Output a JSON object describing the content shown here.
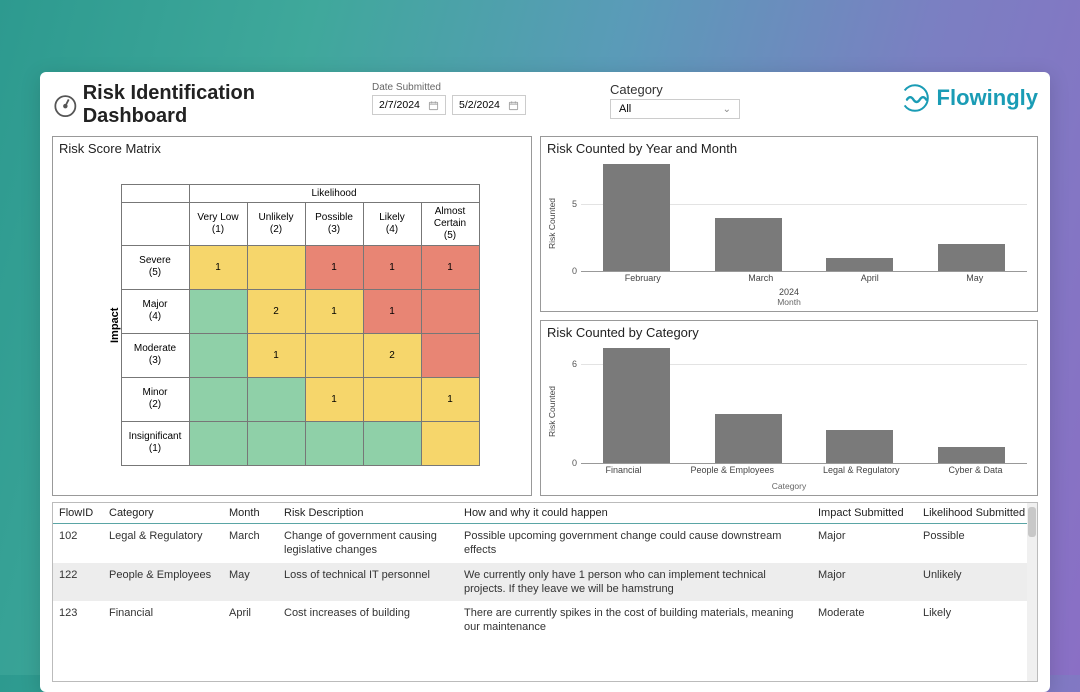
{
  "header": {
    "title": "Risk Identification Dashboard",
    "date_label": "Date Submitted",
    "date_from": "2/7/2024",
    "date_to": "5/2/2024",
    "category_label": "Category",
    "category_value": "All",
    "brand": "Flowingly"
  },
  "matrix": {
    "panel_title": "Risk Score Matrix",
    "likelihood_label": "Likelihood",
    "impact_label": "Impact",
    "col_headers": [
      {
        "name": "Very Low",
        "n": "(1)"
      },
      {
        "name": "Unlikely",
        "n": "(2)"
      },
      {
        "name": "Possible",
        "n": "(3)"
      },
      {
        "name": "Likely",
        "n": "(4)"
      },
      {
        "name": "Almost Certain",
        "n": "(5)"
      }
    ],
    "row_headers": [
      {
        "name": "Severe",
        "n": "(5)"
      },
      {
        "name": "Major",
        "n": "(4)"
      },
      {
        "name": "Moderate",
        "n": "(3)"
      },
      {
        "name": "Minor",
        "n": "(2)"
      },
      {
        "name": "Insignificant",
        "n": "(1)"
      }
    ],
    "cells": [
      [
        {
          "v": "1",
          "c": "y"
        },
        {
          "v": "",
          "c": "y"
        },
        {
          "v": "1",
          "c": "r"
        },
        {
          "v": "1",
          "c": "r"
        },
        {
          "v": "1",
          "c": "r"
        }
      ],
      [
        {
          "v": "",
          "c": "g"
        },
        {
          "v": "2",
          "c": "y"
        },
        {
          "v": "1",
          "c": "y"
        },
        {
          "v": "1",
          "c": "r"
        },
        {
          "v": "",
          "c": "r"
        }
      ],
      [
        {
          "v": "",
          "c": "g"
        },
        {
          "v": "1",
          "c": "y"
        },
        {
          "v": "",
          "c": "y"
        },
        {
          "v": "2",
          "c": "y"
        },
        {
          "v": "",
          "c": "r"
        }
      ],
      [
        {
          "v": "",
          "c": "g"
        },
        {
          "v": "",
          "c": "g"
        },
        {
          "v": "1",
          "c": "y"
        },
        {
          "v": "",
          "c": "y"
        },
        {
          "v": "1",
          "c": "y"
        }
      ],
      [
        {
          "v": "",
          "c": "g"
        },
        {
          "v": "",
          "c": "g"
        },
        {
          "v": "",
          "c": "g"
        },
        {
          "v": "",
          "c": "g"
        },
        {
          "v": "",
          "c": "y"
        }
      ]
    ]
  },
  "chart_data": [
    {
      "id": "by_month",
      "title": "Risk Counted by Year and Month",
      "type": "bar",
      "ylabel": "Risk Counted",
      "xlabel": "Month",
      "group_label": "2024",
      "yticks": [
        0,
        5
      ],
      "ylim": [
        0,
        8
      ],
      "categories": [
        "February",
        "March",
        "April",
        "May"
      ],
      "values": [
        8,
        4,
        1,
        2
      ]
    },
    {
      "id": "by_category",
      "title": "Risk Counted by Category",
      "type": "bar",
      "ylabel": "Risk Counted",
      "xlabel": "Category",
      "yticks": [
        0,
        6
      ],
      "ylim": [
        0,
        7
      ],
      "categories": [
        "Financial",
        "People & Employees",
        "Legal & Regulatory",
        "Cyber & Data"
      ],
      "values": [
        7,
        3,
        2,
        1
      ]
    }
  ],
  "table": {
    "headers": [
      "FlowID",
      "Category",
      "Month",
      "Risk Description",
      "How and why it could happen",
      "Impact Submitted",
      "Likelihood Submitted"
    ],
    "rows": [
      {
        "FlowID": "102",
        "Category": "Legal & Regulatory",
        "Month": "March",
        "Risk": "Change of government causing legislative changes",
        "How": "Possible upcoming government change could cause downstream effects",
        "Impact": "Major",
        "Likelihood": "Possible"
      },
      {
        "FlowID": "122",
        "Category": "People & Employees",
        "Month": "May",
        "Risk": "Loss of technical IT personnel",
        "How": "We currently only have 1 person who can implement technical projects. If they leave we will be hamstrung",
        "Impact": "Major",
        "Likelihood": "Unlikely"
      },
      {
        "FlowID": "123",
        "Category": "Financial",
        "Month": "April",
        "Risk": "Cost increases of building",
        "How": "There are currently spikes in the cost of building materials, meaning our maintenance",
        "Impact": "Moderate",
        "Likelihood": "Likely"
      }
    ]
  }
}
